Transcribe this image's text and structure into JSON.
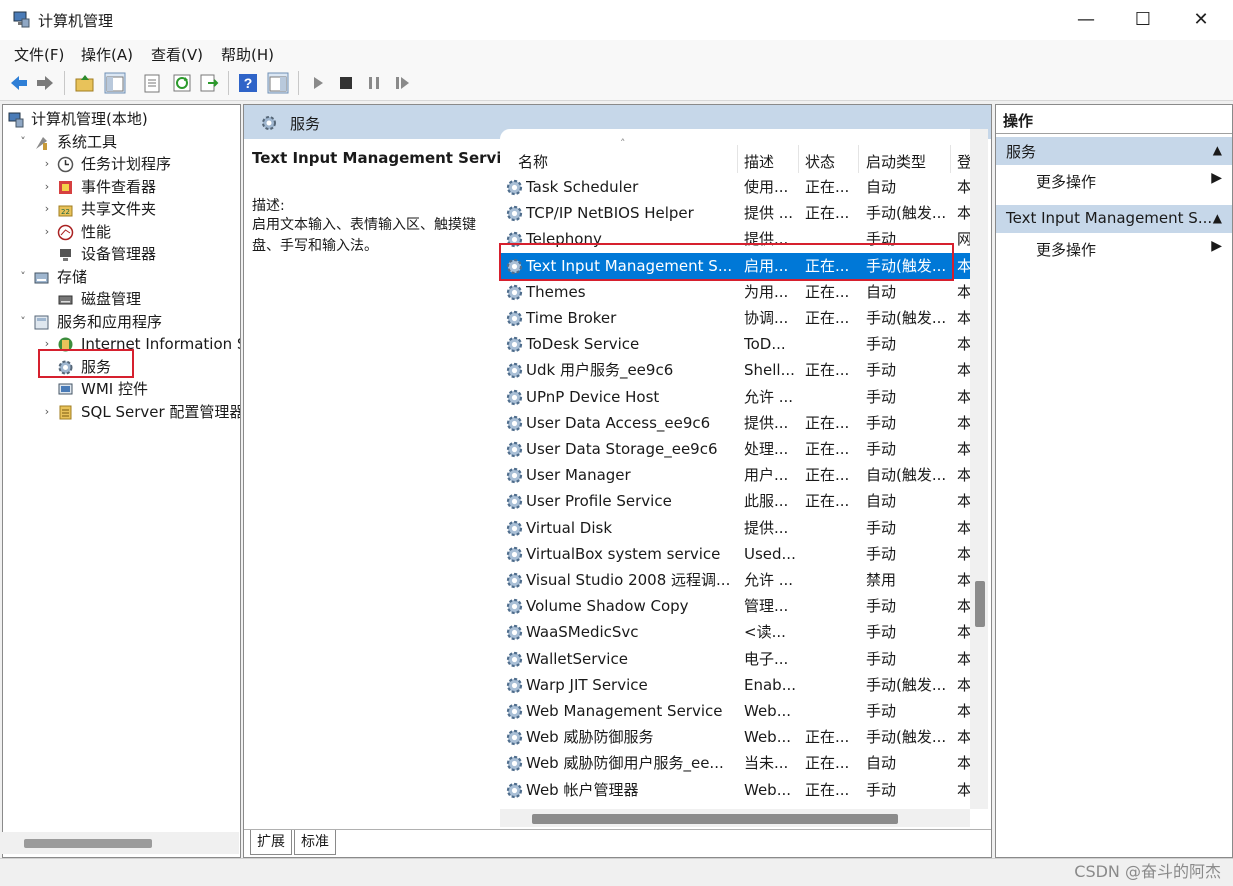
{
  "window": {
    "title": "计算机管理",
    "minimize": "—",
    "maximize": "☐",
    "close": "✕"
  },
  "menu": [
    "文件(F)",
    "操作(A)",
    "查看(V)",
    "帮助(H)"
  ],
  "toolbar": {
    "icons": [
      "back-icon",
      "forward-icon",
      "up-folder-icon",
      "show-hide-tree-icon",
      "properties-icon",
      "refresh-icon",
      "export-icon",
      "help-icon",
      "show-hide-action-pane-icon",
      "start-service-icon",
      "stop-service-icon",
      "pause-service-icon",
      "restart-service-icon"
    ]
  },
  "tree": {
    "items": [
      {
        "label": "计算机管理(本地)",
        "icon": "computer-management-icon",
        "chevron": ""
      },
      {
        "label": "系统工具",
        "icon": "system-tools-icon",
        "chevron": "˅"
      },
      {
        "label": "任务计划程序",
        "icon": "task-scheduler-icon",
        "chevron": "›"
      },
      {
        "label": "事件查看器",
        "icon": "event-viewer-icon",
        "chevron": "›"
      },
      {
        "label": "共享文件夹",
        "icon": "shared-folders-icon",
        "chevron": "›"
      },
      {
        "label": "性能",
        "icon": "performance-icon",
        "chevron": "›"
      },
      {
        "label": "设备管理器",
        "icon": "device-manager-icon",
        "chevron": ""
      },
      {
        "label": "存储",
        "icon": "storage-icon",
        "chevron": "˅"
      },
      {
        "label": "磁盘管理",
        "icon": "disk-management-icon",
        "chevron": ""
      },
      {
        "label": "服务和应用程序",
        "icon": "services-apps-icon",
        "chevron": "˅"
      },
      {
        "label": "Internet Information Se",
        "icon": "iis-icon",
        "chevron": "›"
      },
      {
        "label": "服务",
        "icon": "services-icon",
        "chevron": ""
      },
      {
        "label": "WMI 控件",
        "icon": "wmi-icon",
        "chevron": ""
      },
      {
        "label": "SQL Server 配置管理器",
        "icon": "sql-server-icon",
        "chevron": "›"
      }
    ]
  },
  "middle": {
    "header": "服务",
    "description_title": "Text Input Management Service",
    "description_label": "描述:",
    "description_text": "启用文本输入、表情输入区、触摸键盘、手写和输入法。",
    "columns": [
      "名称",
      "描述",
      "状态",
      "启动类型",
      "登"
    ],
    "sort_indicator": "˄",
    "rows": [
      {
        "name": "Task Scheduler",
        "desc": "使用...",
        "status": "正在...",
        "startup": "自动",
        "logon": "本"
      },
      {
        "name": "TCP/IP NetBIOS Helper",
        "desc": "提供 ...",
        "status": "正在...",
        "startup": "手动(触发...",
        "logon": "本"
      },
      {
        "name": "Telephony",
        "desc": "提供...",
        "status": "",
        "startup": "手动",
        "logon": "网"
      },
      {
        "name": "Text Input Management S...",
        "desc": "启用...",
        "status": "正在...",
        "startup": "手动(触发...",
        "logon": "本",
        "selected": true
      },
      {
        "name": "Themes",
        "desc": "为用...",
        "status": "正在...",
        "startup": "自动",
        "logon": "本"
      },
      {
        "name": "Time Broker",
        "desc": "协调...",
        "status": "正在...",
        "startup": "手动(触发...",
        "logon": "本"
      },
      {
        "name": "ToDesk Service",
        "desc": "ToD...",
        "status": "",
        "startup": "手动",
        "logon": "本"
      },
      {
        "name": "Udk 用户服务_ee9c6",
        "desc": "Shell...",
        "status": "正在...",
        "startup": "手动",
        "logon": "本"
      },
      {
        "name": "UPnP Device Host",
        "desc": "允许 ...",
        "status": "",
        "startup": "手动",
        "logon": "本"
      },
      {
        "name": "User Data Access_ee9c6",
        "desc": "提供...",
        "status": "正在...",
        "startup": "手动",
        "logon": "本"
      },
      {
        "name": "User Data Storage_ee9c6",
        "desc": "处理...",
        "status": "正在...",
        "startup": "手动",
        "logon": "本"
      },
      {
        "name": "User Manager",
        "desc": "用户...",
        "status": "正在...",
        "startup": "自动(触发...",
        "logon": "本"
      },
      {
        "name": "User Profile Service",
        "desc": "此服...",
        "status": "正在...",
        "startup": "自动",
        "logon": "本"
      },
      {
        "name": "Virtual Disk",
        "desc": "提供...",
        "status": "",
        "startup": "手动",
        "logon": "本"
      },
      {
        "name": "VirtualBox system service",
        "desc": "Used...",
        "status": "",
        "startup": "手动",
        "logon": "本"
      },
      {
        "name": "Visual Studio 2008 远程调...",
        "desc": "允许 ...",
        "status": "",
        "startup": "禁用",
        "logon": "本"
      },
      {
        "name": "Volume Shadow Copy",
        "desc": "管理...",
        "status": "",
        "startup": "手动",
        "logon": "本"
      },
      {
        "name": "WaaSMedicSvc",
        "desc": "<读...",
        "status": "",
        "startup": "手动",
        "logon": "本"
      },
      {
        "name": "WalletService",
        "desc": "电子...",
        "status": "",
        "startup": "手动",
        "logon": "本"
      },
      {
        "name": "Warp JIT Service",
        "desc": "Enab...",
        "status": "",
        "startup": "手动(触发...",
        "logon": "本"
      },
      {
        "name": "Web Management Service",
        "desc": "Web...",
        "status": "",
        "startup": "手动",
        "logon": "本"
      },
      {
        "name": "Web 威胁防御服务",
        "desc": "Web...",
        "status": "正在...",
        "startup": "手动(触发...",
        "logon": "本"
      },
      {
        "name": "Web 威胁防御用户服务_ee...",
        "desc": "当未...",
        "status": "正在...",
        "startup": "自动",
        "logon": "本"
      },
      {
        "name": "Web 帐户管理器",
        "desc": "Web...",
        "status": "正在...",
        "startup": "手动",
        "logon": "本"
      }
    ],
    "tabs": [
      "扩展",
      "标准"
    ]
  },
  "actions": {
    "header": "操作",
    "sections": [
      {
        "title": "服务",
        "item": "更多操作"
      },
      {
        "title": "Text Input Management S...",
        "item": "更多操作"
      }
    ],
    "collapse_glyph": "▲",
    "submenu_glyph": "▶"
  },
  "watermark": "CSDN @奋斗的阿杰",
  "colors": {
    "selection": "#0078d7",
    "section_bg": "#c6d7e9",
    "highlight_box": "#d6202e"
  }
}
